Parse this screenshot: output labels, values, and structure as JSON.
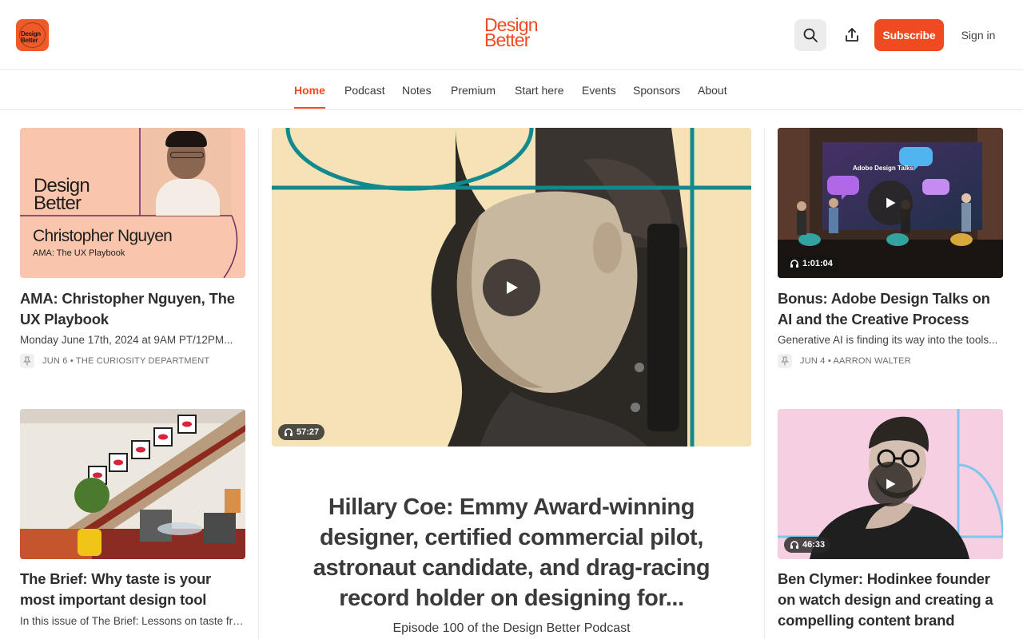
{
  "header": {
    "logo_text": [
      "Design",
      "Better"
    ],
    "brand": [
      "Design",
      "Better"
    ],
    "subscribe_label": "Subscribe",
    "signin_label": "Sign in"
  },
  "nav": {
    "items": [
      {
        "label": "Home",
        "active": true
      },
      {
        "label": "Podcast"
      },
      {
        "label": "Notes"
      },
      {
        "label": "Premium"
      },
      {
        "label": "Start here"
      },
      {
        "label": "Events"
      },
      {
        "label": "Sponsors"
      },
      {
        "label": "About"
      }
    ]
  },
  "left": {
    "cards": [
      {
        "thumb_title": [
          "Design",
          "Better"
        ],
        "thumb_name": "Christopher Nguyen",
        "thumb_caption": "AMA: The UX Playbook",
        "title": "AMA: Christopher Nguyen, The UX Playbook",
        "subtitle": "Monday June 17th, 2024 at 9AM PT/12PM...",
        "meta": "JUN 6 • THE CURIOSITY DEPARTMENT"
      },
      {
        "title": "The Brief: Why taste is your most important design tool",
        "subtitle": "In this issue of The Brief: Lessons on taste fro..."
      }
    ]
  },
  "feature": {
    "duration": "57:27",
    "title": "Hillary Coe: Emmy Award-winning designer, certified commercial pilot, astronaut candidate, and drag-racing record holder on designing for...",
    "subtitle": "Episode 100 of the Design Better Podcast"
  },
  "right": {
    "cards": [
      {
        "thumb_caption": "Adobe Design Talks",
        "duration": "1:01:04",
        "title": "Bonus: Adobe Design Talks on AI and the Creative Process",
        "subtitle": "Generative AI is finding its way into the tools...",
        "meta": "JUN 4 • AARRON WALTER"
      },
      {
        "duration": "46:33",
        "title": "Ben Clymer: Hodinkee founder on watch design and creating a compelling content brand"
      }
    ]
  },
  "colors": {
    "accent": "#f04a23",
    "peach": "#f9c6ad",
    "teal": "#12898d",
    "cream": "#f6e3b8",
    "pink": "#f5cfe1"
  }
}
